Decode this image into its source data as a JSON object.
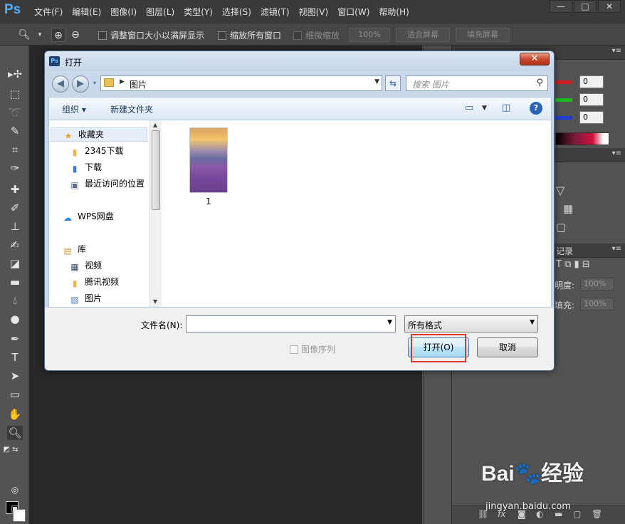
{
  "app": {
    "logo": "Ps",
    "menu": [
      "文件(F)",
      "编辑(E)",
      "图像(I)",
      "图层(L)",
      "类型(Y)",
      "选择(S)",
      "滤镜(T)",
      "视图(V)",
      "窗口(W)",
      "帮助(H)"
    ],
    "window_controls": {
      "minimize": "—",
      "maximize": "□",
      "close": "✕"
    }
  },
  "options_bar": {
    "resize_windows_label": "调整窗口大小以满屏显示",
    "zoom_all_label": "缩放所有窗口",
    "scrubby_zoom_label": "细微缩放",
    "zoom_percent": "100%",
    "fit_screen_label": "适合屏幕",
    "fill_screen_label": "填充屏幕"
  },
  "color_panel": {
    "channels": [
      {
        "color": "#d21d1d",
        "value": "0"
      },
      {
        "color": "#1fb81f",
        "value": "0"
      },
      {
        "color": "#1e3fd6",
        "value": "0"
      }
    ]
  },
  "layers_panel": {
    "history_tab_fragment": "记录",
    "opacity_label": "明度:",
    "opacity_value": "100%",
    "fill_label": "填充:",
    "fill_value": "100%"
  },
  "dialog": {
    "title": "打开",
    "close_glyph": "✕",
    "address_path": "图片",
    "search_placeholder": "搜索 图片",
    "organize_label": "组织 ▾",
    "new_folder_label": "新建文件夹",
    "help_glyph": "?",
    "nav_items": [
      {
        "label": "收藏夹",
        "icon": "star-icon",
        "glyph": "★"
      },
      {
        "label": "2345下载",
        "icon": "folder-icon",
        "glyph": "▮"
      },
      {
        "label": "下载",
        "icon": "download-folder-icon",
        "glyph": "▮"
      },
      {
        "label": "最近访问的位置",
        "icon": "recent-places-icon",
        "glyph": "▣"
      },
      {
        "label": "WPS网盘",
        "icon": "cloud-icon",
        "glyph": "☁"
      },
      {
        "label": "库",
        "icon": "library-icon",
        "glyph": "▤"
      },
      {
        "label": "视频",
        "icon": "video-icon",
        "glyph": "▦"
      },
      {
        "label": "腾讯视频",
        "icon": "folder-icon",
        "glyph": "▮"
      },
      {
        "label": "图片",
        "icon": "pictures-icon",
        "glyph": "▧"
      }
    ],
    "files": [
      {
        "name": "1"
      }
    ],
    "filename_label": "文件名(N):",
    "filename_value": "",
    "filter_value": "所有格式",
    "image_sequence_label": "图像序列",
    "open_button": "打开(O)",
    "cancel_button": "取消"
  },
  "watermark": {
    "logo_text": "Bai🐾经验",
    "url": "jingyan.baidu.com"
  }
}
